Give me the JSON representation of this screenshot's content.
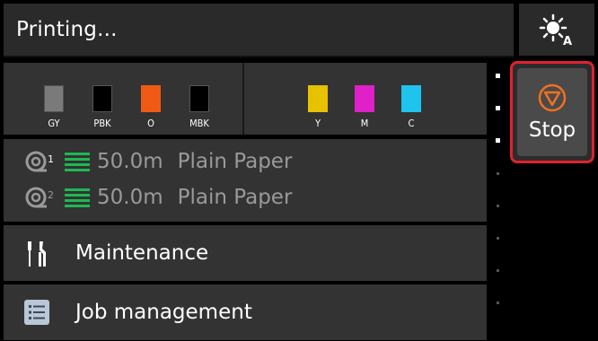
{
  "header": {
    "status": "Printing...",
    "display_icon": "display-brightness-icon"
  },
  "inks": {
    "left": [
      {
        "label": "GY",
        "color": "#7a7a7a"
      },
      {
        "label": "PBK",
        "color": "#000000"
      },
      {
        "label": "O",
        "color": "#f05a14"
      },
      {
        "label": "MBK",
        "color": "#000000"
      }
    ],
    "right": [
      {
        "label": "Y",
        "color": "#e6c200"
      },
      {
        "label": "M",
        "color": "#e020c8"
      },
      {
        "label": "C",
        "color": "#1ec4ee"
      }
    ]
  },
  "paper": [
    {
      "roll": "1",
      "amount": "50.0m",
      "type": "Plain Paper"
    },
    {
      "roll": "2",
      "amount": "50.0m",
      "type": "Plain Paper"
    }
  ],
  "menu": {
    "maintenance": "Maintenance",
    "job_management": "Job management"
  },
  "stop": {
    "label": "Stop",
    "accent": "#e0222e",
    "icon_color": "#f07020"
  }
}
